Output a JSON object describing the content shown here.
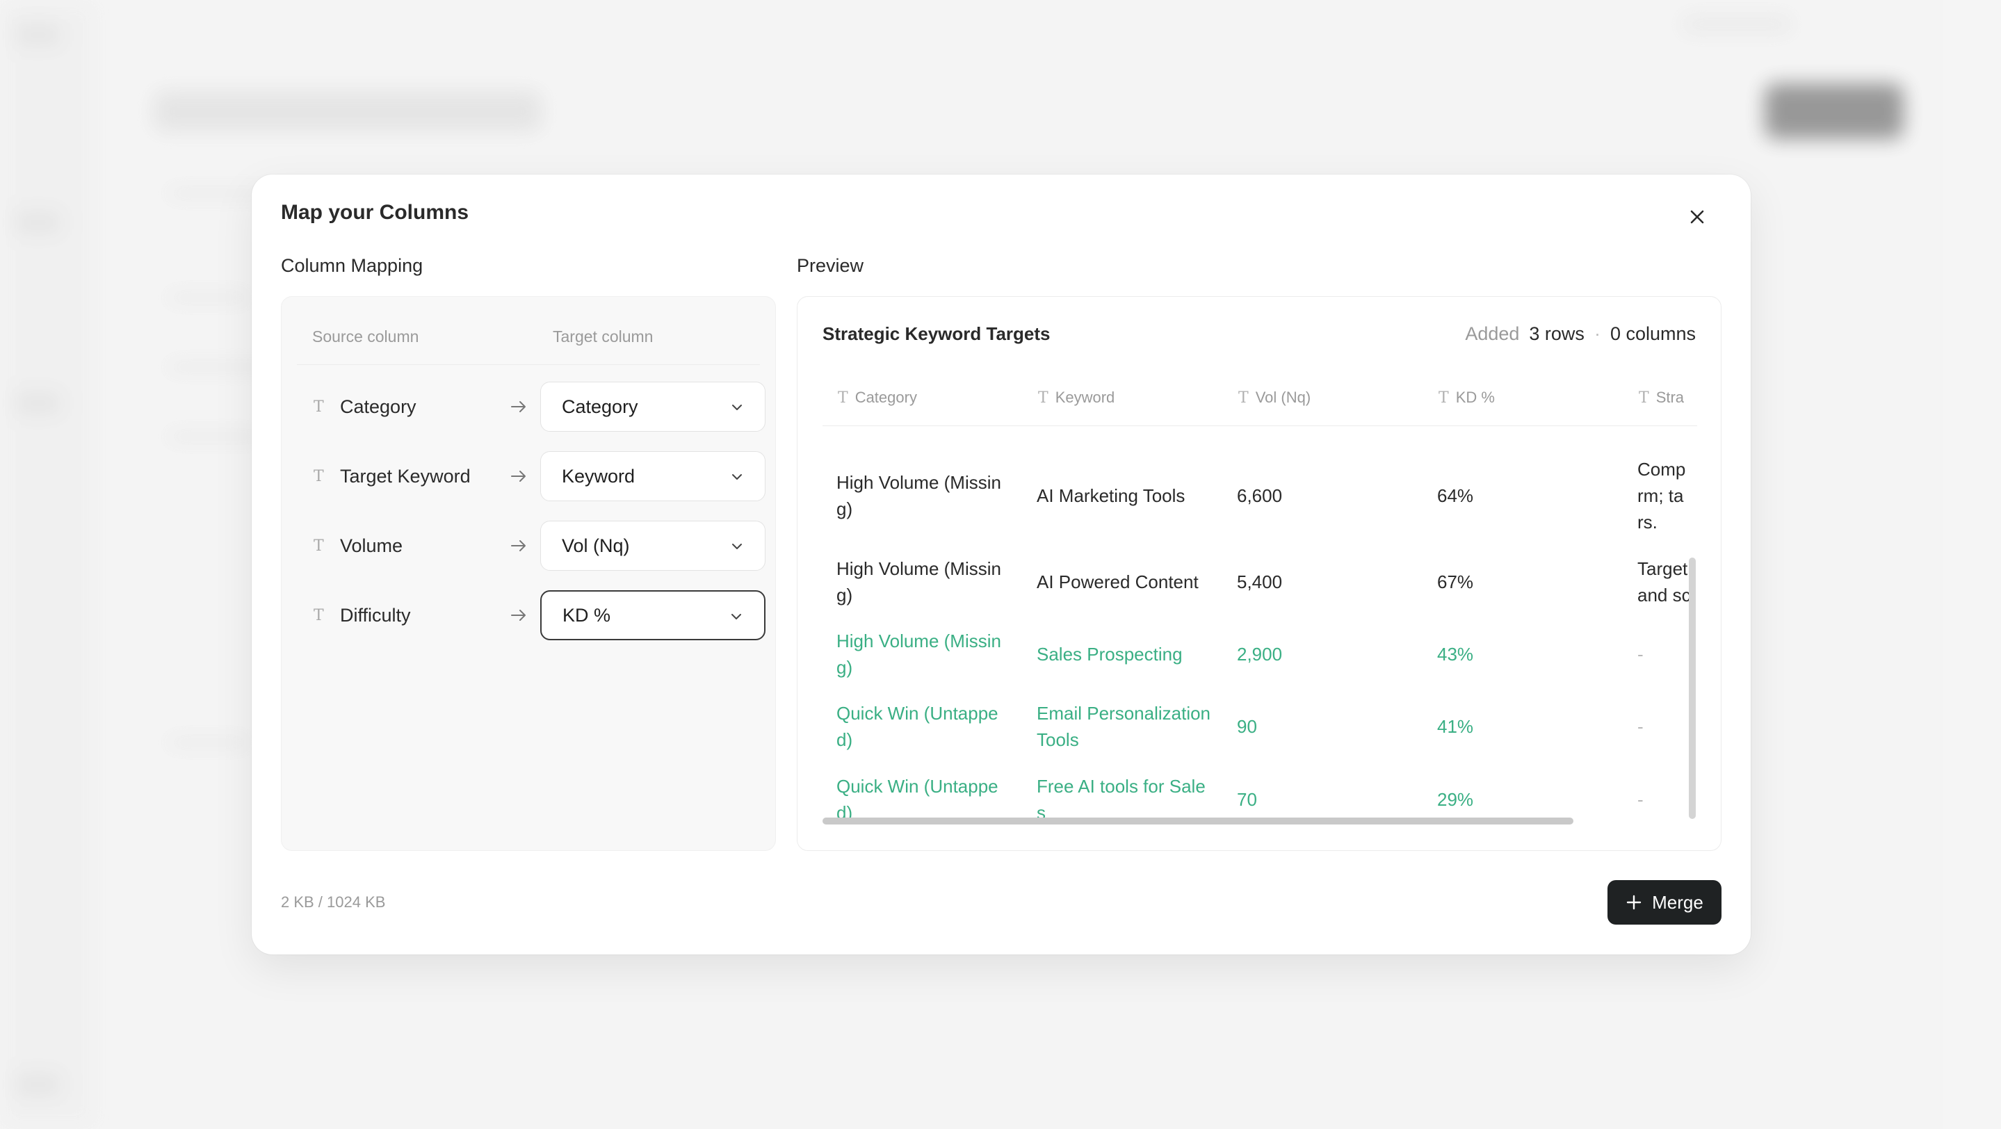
{
  "modal": {
    "title": "Map your Columns",
    "close_icon": "close-icon"
  },
  "mapping": {
    "section_label": "Column Mapping",
    "source_header": "Source column",
    "target_header": "Target column",
    "type_icon_glyph": "T",
    "rows": [
      {
        "source": "Category",
        "target": "Category",
        "focused": false
      },
      {
        "source": "Target Keyword",
        "target": "Keyword",
        "focused": false
      },
      {
        "source": "Volume",
        "target": "Vol (Nq)",
        "focused": false
      },
      {
        "source": "Difficulty",
        "target": "KD %",
        "focused": true
      }
    ]
  },
  "preview": {
    "section_label": "Preview",
    "table_title": "Strategic Keyword Targets",
    "stats": {
      "added_label": "Added",
      "rows": "3 rows",
      "separator": "·",
      "columns": "0 columns"
    },
    "columns": [
      "Category",
      "Keyword",
      "Vol (Nq)",
      "KD %",
      "Stra"
    ],
    "rows": [
      {
        "cells": [
          "High Volume (Missing)",
          "AI Marketing Tools",
          "6,600",
          "64%",
          "Comprm; tars."
        ],
        "added": false
      },
      {
        "cells": [
          "High Volume (Missing)",
          "AI Powered Content",
          "5,400",
          "67%",
          "Target and sc"
        ],
        "added": false
      },
      {
        "cells": [
          "High Volume (Missing)",
          "Sales Prospecting",
          "2,900",
          "43%",
          "-"
        ],
        "added": true
      },
      {
        "cells": [
          "Quick Win (Untapped)",
          "Email Personalization Tools",
          "90",
          "41%",
          "-"
        ],
        "added": true
      },
      {
        "cells": [
          "Quick Win (Untapped)",
          "Free AI tools for Sales",
          "70",
          "29%",
          "-"
        ],
        "added": true
      }
    ],
    "added_color": "#3aaf84"
  },
  "footer": {
    "size_info": "2 KB / 1024 KB",
    "merge_label": "Merge",
    "merge_icon": "plus-icon"
  }
}
